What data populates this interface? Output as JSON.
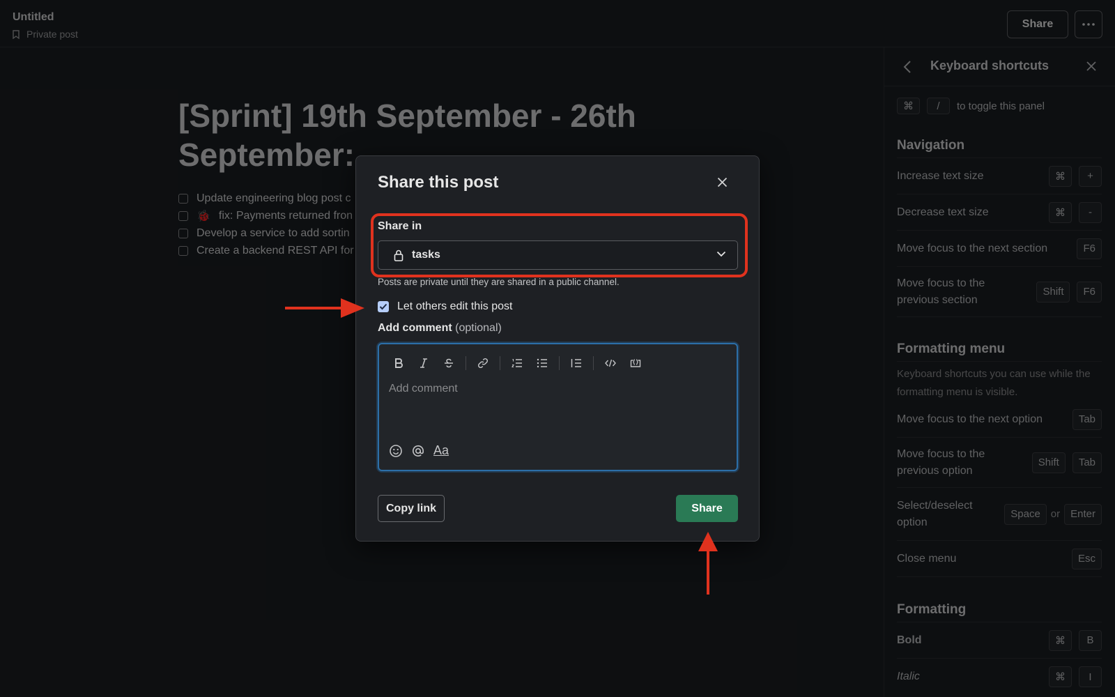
{
  "topbar": {
    "title": "Untitled",
    "subtitle": "Private post",
    "share_label": "Share"
  },
  "document": {
    "heading": "[Sprint] 19th September - 26th September:",
    "tasks": [
      {
        "text": "Update engineering blog post c"
      },
      {
        "text": "fix: Payments returned fron",
        "emoji": "🐞"
      },
      {
        "text": "Develop a service to add sortin"
      },
      {
        "text": "Create a backend REST API for"
      }
    ]
  },
  "panel": {
    "title": "Keyboard shortcuts",
    "toggle": {
      "key1": "⌘",
      "key2": "/",
      "text": "to toggle this panel"
    },
    "sections": {
      "navigation": {
        "title": "Navigation",
        "rows": [
          {
            "label": "Increase text size",
            "keys": [
              "⌘",
              "+"
            ]
          },
          {
            "label": "Decrease text size",
            "keys": [
              "⌘",
              "-"
            ]
          },
          {
            "label": "Move focus to the next section",
            "keys": [
              "F6"
            ]
          },
          {
            "label": "Move focus to the previous section",
            "keys": [
              "Shift",
              "F6"
            ]
          }
        ]
      },
      "formatting_menu": {
        "title": "Formatting menu",
        "description": "Keyboard shortcuts you can use while the formatting menu is visible.",
        "rows": [
          {
            "label": "Move focus to the next option",
            "keys": [
              "Tab"
            ]
          },
          {
            "label": "Move focus to the previous option",
            "keys": [
              "Shift",
              "Tab"
            ]
          },
          {
            "label": "Select/deselect option",
            "keys": [
              "Space",
              "or",
              "Enter"
            ]
          },
          {
            "label": "Close menu",
            "keys": [
              "Esc"
            ]
          }
        ]
      },
      "formatting": {
        "title": "Formatting",
        "rows": [
          {
            "label": "Bold",
            "keys": [
              "⌘",
              "B"
            ]
          },
          {
            "label": "Italic",
            "keys": [
              "⌘",
              "I"
            ]
          }
        ]
      }
    }
  },
  "modal": {
    "title": "Share this post",
    "share_in_label": "Share in",
    "channel": "tasks",
    "hint": "Posts are private until they are shared in a public channel.",
    "let_edit_label": "Let others edit this post",
    "let_edit_checked": true,
    "comment_label": "Add comment",
    "comment_optional": "(optional)",
    "comment_placeholder": "Add comment",
    "format_button": "Aa",
    "copy_link_label": "Copy link",
    "share_label": "Share"
  },
  "colors": {
    "background": "#1a1d21",
    "modal_bg": "#1e2024",
    "share_button": "#2a7a55",
    "annotation_red": "#e0321e",
    "focus_ring": "#2c6fa8",
    "checkbox": "#b5cdf8"
  }
}
